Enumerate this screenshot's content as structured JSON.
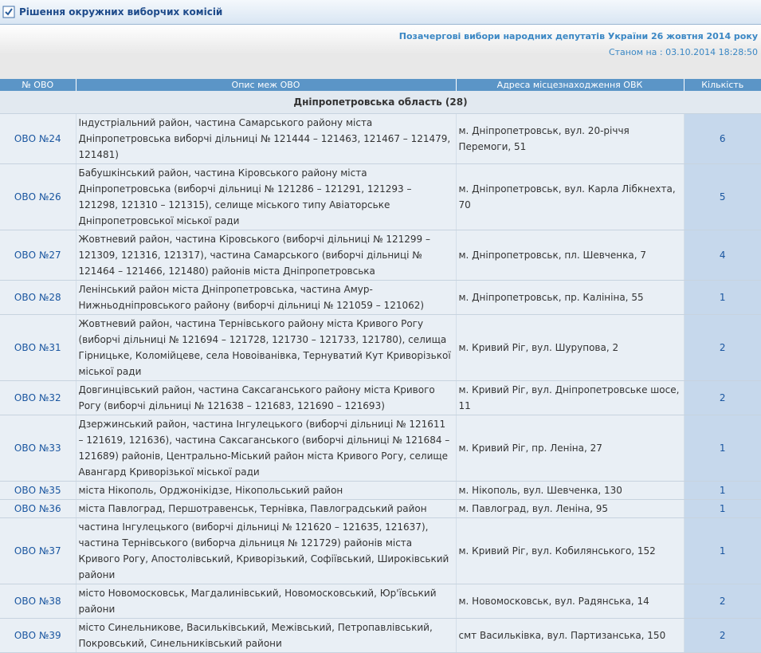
{
  "header": {
    "title": "Рішення окружних виборчих комісій"
  },
  "info": {
    "election": "Позачергові вибори народних депутатів України 26 жовтня 2014 року",
    "as_of": "Станом на : 03.10.2014 18:28:50"
  },
  "table": {
    "columns": [
      "№ ОВО",
      "Опис меж ОВО",
      "Адреса місцезнаходження ОВК",
      "Кількість"
    ],
    "region": "Дніпропетровська область (28)",
    "rows": [
      {
        "ovo": "ОВО №24",
        "desc": "Індустріальний район, частина Самарського району міста Дніпропетровська виборчі дільниці № 121444 – 121463, 121467 – 121479, 121481)",
        "addr": "м. Дніпропетровськ, вул. 20-річчя Перемоги, 51",
        "count": "6"
      },
      {
        "ovo": "ОВО №26",
        "desc": "Бабушкінський район, частина Кіровського району міста Дніпропетровська (виборчі дільниці № 121286 – 121291, 121293 – 121298, 121310 – 121315), селище міського типу Авіаторське Дніпропетровської міської ради",
        "addr": "м. Дніпропетровськ, вул. Карла Лібкнехта, 70",
        "count": "5"
      },
      {
        "ovo": "ОВО №27",
        "desc": "Жовтневий район, частина Кіровського (виборчі дільниці № 121299 – 121309, 121316, 121317), частина Самарського (виборчі дільниці № 121464 – 121466, 121480) районів міста Дніпропетровська",
        "addr": "м. Дніпропетровськ, пл. Шевченка, 7",
        "count": "4"
      },
      {
        "ovo": "ОВО №28",
        "desc": "Ленінський район міста Дніпропетровська, частина Амур-Нижньодніпровського району (виборчі дільниці № 121059 – 121062)",
        "addr": "м. Дніпропетровськ, пр. Калініна, 55",
        "count": "1"
      },
      {
        "ovo": "ОВО №31",
        "desc": "Жовтневий район, частина Тернівського району міста Кривого Рогу (виборчі дільниці № 121694 – 121728, 121730 – 121733, 121780), селища Гірницьке, Коломійцеве, села Новоіванівка, Тернуватий Кут Криворізької міської ради",
        "addr": "м. Кривий Ріг, вул. Шурупова, 2",
        "count": "2"
      },
      {
        "ovo": "ОВО №32",
        "desc": "Довгинцівський район, частина Саксаганського району міста Кривого Рогу (виборчі дільниці № 121638 – 121683, 121690 – 121693)",
        "addr": "м. Кривий Ріг, вул. Дніпропетровське шосе, 11",
        "count": "2"
      },
      {
        "ovo": "ОВО №33",
        "desc": "Дзержинський район, частина Інгулецького (виборчі дільниці № 121611 – 121619, 121636), частина Саксаганського (виборчі дільниці № 121684 – 121689) районів, Центрально-Міський район міста Кривого Рогу, селище Авангард Криворізької міської ради",
        "addr": "м. Кривий Ріг, пр. Леніна, 27",
        "count": "1"
      },
      {
        "ovo": "ОВО №35",
        "desc": "міста Нікополь, Орджонікідзе, Нікопольський район",
        "addr": "м. Нікополь, вул. Шевченка, 130",
        "count": "1"
      },
      {
        "ovo": "ОВО №36",
        "desc": "міста Павлоград, Першотравенськ, Тернівка, Павлоградський район",
        "addr": "м. Павлоград, вул. Леніна, 95",
        "count": "1"
      },
      {
        "ovo": "ОВО №37",
        "desc": "частина Інгулецького (виборчі дільниці № 121620 – 121635, 121637), частина Тернівського (виборча дільниця № 121729) районів міста Кривого Рогу, Апостолівський, Криворізький, Софіївський, Широківський райони",
        "addr": "м. Кривий Ріг, вул. Кобилянського, 152",
        "count": "1"
      },
      {
        "ovo": "ОВО №38",
        "desc": "місто Новомосковськ, Магдалинівський, Новомосковський, Юр'ївський райони",
        "addr": "м. Новомосковськ, вул. Радянська, 14",
        "count": "2"
      },
      {
        "ovo": "ОВО №39",
        "desc": "місто Синельникове, Васильківський, Межівський, Петропавлівський, Покровський, Синельниківський райони",
        "addr": "смт Васильківка, вул. Партизанська, 150",
        "count": "2"
      }
    ]
  }
}
